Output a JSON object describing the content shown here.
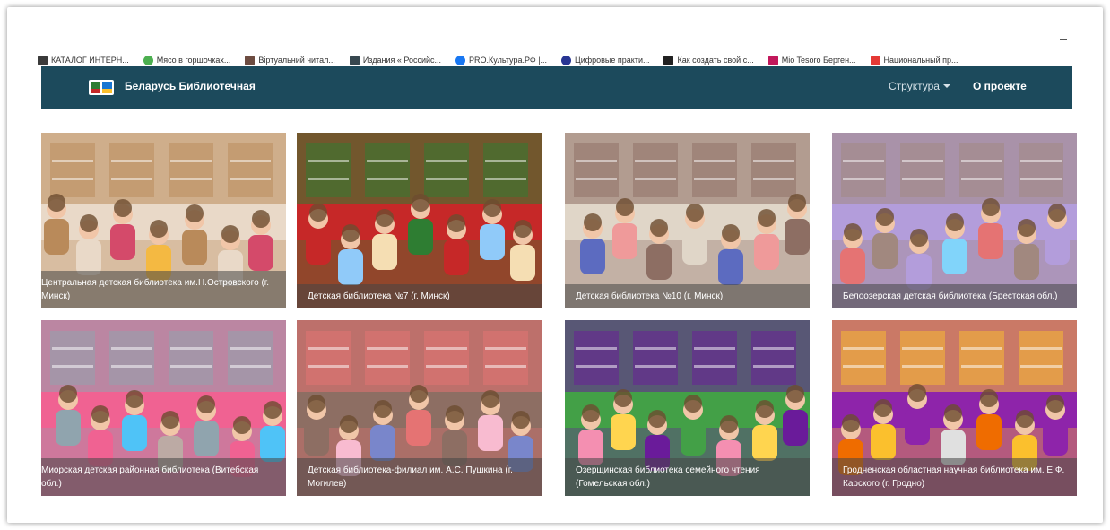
{
  "bookmarks": [
    {
      "label": "КАТАЛОГ ИНТЕРН...",
      "icon": "catalog-icon",
      "color": "#3a3a3a"
    },
    {
      "label": "Мясо в горшочках...",
      "icon": "recipe-icon",
      "color": "#4caf50"
    },
    {
      "label": "Віртуальний читал...",
      "icon": "reader-icon",
      "color": "#6d4c41"
    },
    {
      "label": "Издания « Российс...",
      "icon": "editions-icon",
      "color": "#37474f"
    },
    {
      "label": "PRO.Культура.РФ |...",
      "icon": "facebook-icon",
      "color": "#1877f2"
    },
    {
      "label": "Цифровые практи...",
      "icon": "globe-icon",
      "color": "#283593"
    },
    {
      "label": "Как создать свой с...",
      "icon": "site-icon",
      "color": "#212121"
    },
    {
      "label": "Mio Tesoro Берген...",
      "icon": "flag-icon",
      "color": "#c2185b"
    },
    {
      "label": "Национальный пр...",
      "icon": "mail-icon",
      "color": "#e53935"
    }
  ],
  "navbar": {
    "brand": "Беларусь Библиотечная",
    "menu_structure": "Структура",
    "menu_about": "О проекте",
    "bg_color": "#1c4a5c"
  },
  "tiles": [
    {
      "caption": "Центральная детская библиотека им.Н.Островского (г. Минск)",
      "palette": [
        "#b98a5a",
        "#e9d9c8",
        "#d44a6a",
        "#f4b942"
      ]
    },
    {
      "caption": "Детская библиотека №7 (г. Минск)",
      "palette": [
        "#2e7d32",
        "#c62828",
        "#90caf9",
        "#f5deb3"
      ]
    },
    {
      "caption": "Детская библиотека №10 (г. Минск)",
      "palette": [
        "#8d6e63",
        "#e0d6c8",
        "#5c6bc0",
        "#ef9a9a"
      ]
    },
    {
      "caption": "Белоозерская детская библиотека (Брестская обл.)",
      "palette": [
        "#a1887f",
        "#b39ddb",
        "#81d4fa",
        "#e57373"
      ]
    },
    {
      "caption": "Миорская детская районная библиотека (Витебская обл.)",
      "palette": [
        "#90a4ae",
        "#f06292",
        "#4fc3f7",
        "#bcaaa4"
      ]
    },
    {
      "caption": "Детская библиотека-филиал им. А.С. Пушкина (г. Могилев)",
      "palette": [
        "#e57373",
        "#8d6e63",
        "#f8bbd0",
        "#7986cb"
      ]
    },
    {
      "caption": "Озерщинская библиотека семейного чтения (Гомельская обл.)",
      "palette": [
        "#6a1b9a",
        "#43a047",
        "#f48fb1",
        "#ffd54f"
      ]
    },
    {
      "caption": "Гродненская областная научная библиотека им. Е.Ф. Карского (г. Гродно)",
      "palette": [
        "#fbc02d",
        "#8e24aa",
        "#e0e0e0",
        "#ef6c00"
      ]
    }
  ]
}
